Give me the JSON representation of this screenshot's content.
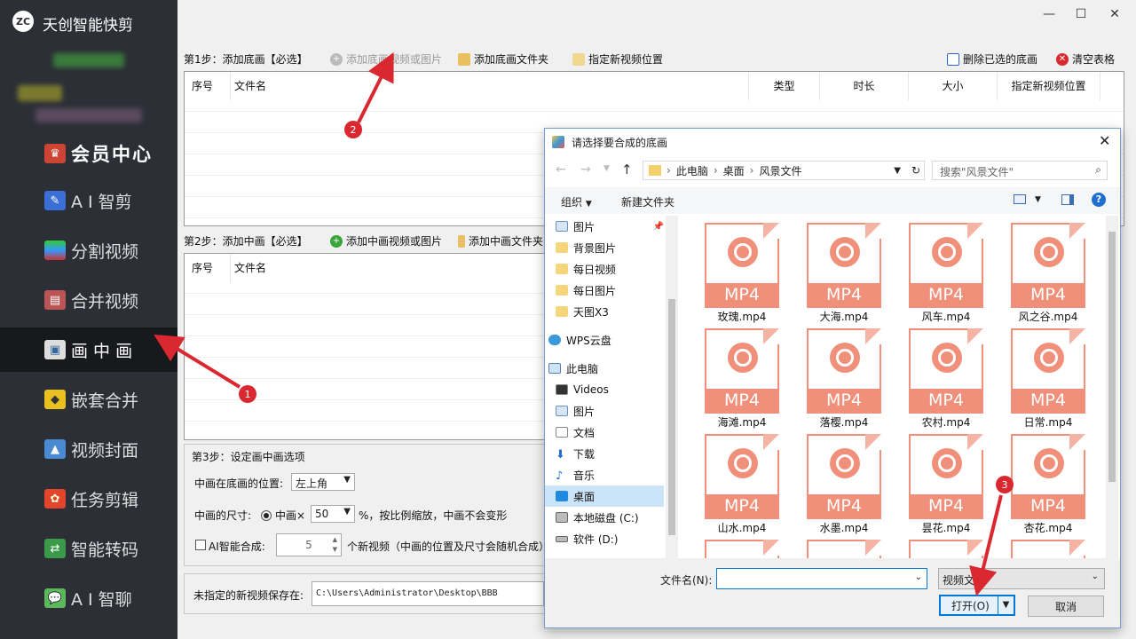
{
  "app": {
    "title": "天创智能快剪",
    "logo_text": "ZC"
  },
  "sidebar": {
    "member": "会员中心",
    "items": [
      {
        "label": "A I 智剪",
        "icon": "ai-edit-icon"
      },
      {
        "label": "分割视频",
        "icon": "split-video-icon"
      },
      {
        "label": "合并视频",
        "icon": "merge-video-icon"
      },
      {
        "label": "画 中 画",
        "icon": "picture-in-picture-icon",
        "active": true
      },
      {
        "label": "嵌套合并",
        "icon": "nest-merge-icon"
      },
      {
        "label": "视频封面",
        "icon": "video-cover-icon"
      },
      {
        "label": "任务剪辑",
        "icon": "task-edit-icon"
      },
      {
        "label": "智能转码",
        "icon": "transcode-icon"
      },
      {
        "label": "A I 智聊",
        "icon": "ai-chat-icon"
      }
    ]
  },
  "window": {
    "minimize": "—",
    "maximize": "☐",
    "close": "✕"
  },
  "step1": {
    "label": "第1步：添加底画【必选】",
    "add_video": "添加底画视频或图片",
    "add_folder": "添加底画文件夹",
    "set_location": "指定新视频位置",
    "delete_selected": "删除已选的底画",
    "clear_table": "清空表格",
    "columns": [
      "序号",
      "文件名",
      "类型",
      "时长",
      "大小",
      "指定新视频位置"
    ]
  },
  "step2": {
    "label": "第2步：添加中画【必选】",
    "add_video": "添加中画视频或图片",
    "add_folder": "添加中画文件夹",
    "columns": [
      "序号",
      "文件名"
    ]
  },
  "step3": {
    "label": "第3步：设定画中画选项",
    "position_label": "中画在底画的位置:",
    "position_value": "左上角",
    "size_label": "中画的尺寸:",
    "size_option": "中画×",
    "size_value": "50",
    "size_suffix": "%，按比例缩放，中画不会变形",
    "ai_label": "AI智能合成:",
    "ai_count": "5",
    "ai_suffix": "个新视频（中画的位置及尺寸会随机合成）"
  },
  "save": {
    "label": "未指定的新视频保存在:",
    "path": "C:\\Users\\Administrator\\Desktop\\BBB"
  },
  "dialog": {
    "title": "请选择要合成的底画",
    "breadcrumb": [
      "此电脑",
      "桌面",
      "风景文件"
    ],
    "search_placeholder": "搜索\"风景文件\"",
    "organize": "组织",
    "new_folder": "新建文件夹",
    "tree": [
      {
        "label": "图片",
        "icon": "pictures-icon"
      },
      {
        "label": "背景图片",
        "icon": "folder-icon"
      },
      {
        "label": "每日视频",
        "icon": "folder-icon"
      },
      {
        "label": "每日图片",
        "icon": "folder-icon"
      },
      {
        "label": "天图X3",
        "icon": "folder-icon"
      },
      {
        "label": "WPS云盘",
        "icon": "cloud-icon"
      },
      {
        "label": "此电脑",
        "icon": "computer-icon"
      },
      {
        "label": "Videos",
        "icon": "videos-icon"
      },
      {
        "label": "图片",
        "icon": "pictures-icon"
      },
      {
        "label": "文档",
        "icon": "documents-icon"
      },
      {
        "label": "下载",
        "icon": "download-icon"
      },
      {
        "label": "音乐",
        "icon": "music-icon"
      },
      {
        "label": "桌面",
        "icon": "desktop-icon",
        "selected": true
      },
      {
        "label": "本地磁盘 (C:)",
        "icon": "drive-icon"
      },
      {
        "label": "软件 (D:)",
        "icon": "drive-icon"
      }
    ],
    "file_badge": "MP4",
    "files": [
      "玫瑰.mp4",
      "大海.mp4",
      "风车.mp4",
      "风之谷.mp4",
      "海滩.mp4",
      "落樱.mp4",
      "农村.mp4",
      "日常.mp4",
      "山水.mp4",
      "水墨.mp4",
      "昙花.mp4",
      "杏花.mp4"
    ],
    "filename_label": "文件名(N):",
    "filename_value": "",
    "filter": "视频文件",
    "open": "打开(O)",
    "cancel": "取消"
  },
  "annotations": [
    "1",
    "2",
    "3"
  ],
  "colors": {
    "sidebar": "#2c2f36",
    "active": "#17191d",
    "mp4": "#f0907a",
    "badge": "#d9282f",
    "accent": "#0078d7"
  }
}
